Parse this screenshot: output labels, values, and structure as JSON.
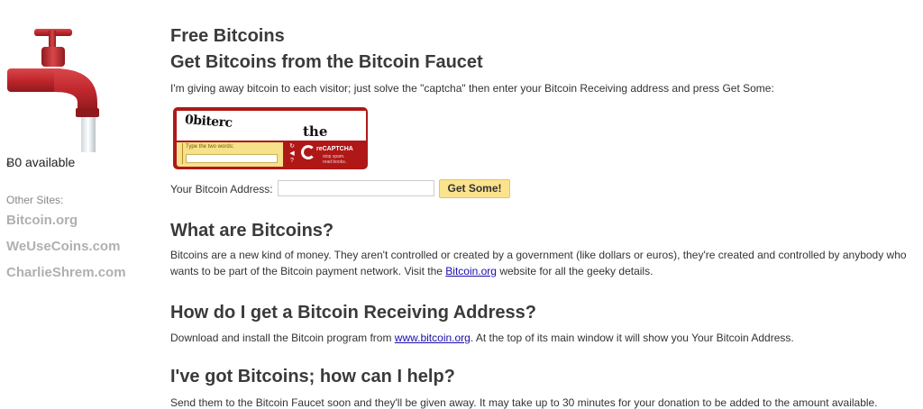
{
  "sidebar": {
    "available": "Ƀ0 available",
    "other_sites_label": "Other Sites:",
    "sites": [
      "Bitcoin.org",
      "WeUseCoins.com",
      "CharlieShrem.com"
    ]
  },
  "main": {
    "title": "Free Bitcoins",
    "subtitle": "Get Bitcoins from the Bitcoin Faucet",
    "intro": "I'm giving away bitcoin to each visitor; just solve the \"captcha\" then enter your Bitcoin Receiving address and press Get Some:",
    "captcha": {
      "word1": "0biterc",
      "word2": "the",
      "prompt": "Type the two words:",
      "brand": "reCAPTCHA",
      "tagline": [
        "stop spam.",
        "read books."
      ],
      "icons": [
        "refresh-icon",
        "audio-icon",
        "help-icon"
      ]
    },
    "address_label": "Your Bitcoin Address:",
    "address_value": "",
    "submit_label": "Get Some!",
    "sections": {
      "what": {
        "heading": "What are Bitcoins?",
        "text_before": "Bitcoins are a new kind of money. They aren't controlled or created by a government (like dollars or euros), they're created and controlled by anybody who wants to be part of the Bitcoin payment network. Visit the ",
        "link": "Bitcoin.org",
        "text_after": " website for all the geeky details."
      },
      "how": {
        "heading": "How do I get a Bitcoin Receiving Address?",
        "text_before": "Download and install the Bitcoin program from ",
        "link": "www.bitcoin.org",
        "text_after": ". At the top of its main window it will show you Your Bitcoin Address."
      },
      "help": {
        "heading": "I've got Bitcoins; how can I help?",
        "text": "Send them to the Bitcoin Faucet soon and they'll be given away. It may take up to 30 minutes for your donation to be added to the amount available."
      }
    }
  },
  "colors": {
    "faucet_red": "#c0272d",
    "captcha_red": "#b01818",
    "captcha_yellow": "#f7e18a",
    "button_yellow": "#fbe28c",
    "link_blue": "#1a0dab",
    "sidebar_link_gray": "#b0b0b0"
  }
}
